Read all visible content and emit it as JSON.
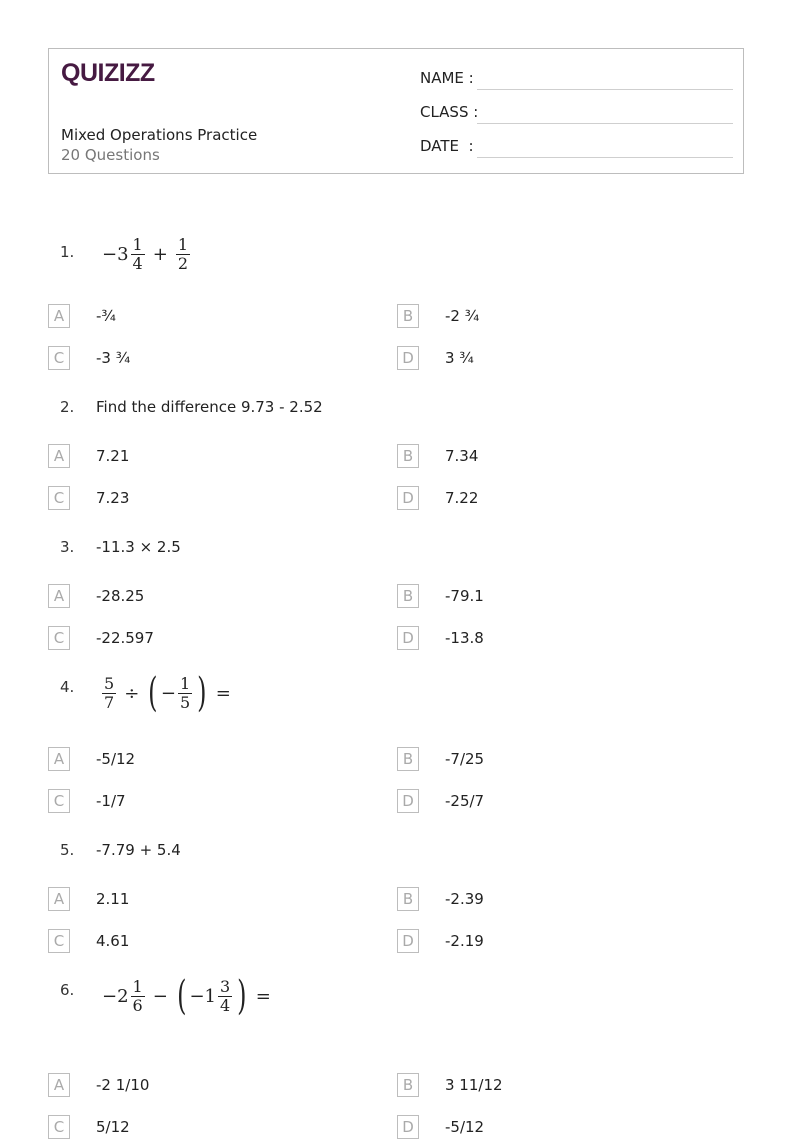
{
  "header": {
    "logo": "QUIZIZZ",
    "title": "Mixed Operations Practice",
    "question_count": "20 Questions",
    "fields": [
      "NAME :",
      "CLASS :",
      "DATE  :"
    ]
  },
  "questions": [
    {
      "number": "1.",
      "type": "math",
      "math": {
        "expr": "-3 1/4 + 1/2"
      },
      "options": [
        {
          "letter": "A",
          "text": "-¾"
        },
        {
          "letter": "B",
          "text": "-2 ¾"
        },
        {
          "letter": "C",
          "text": "-3 ¾"
        },
        {
          "letter": "D",
          "text": "3 ¾"
        }
      ]
    },
    {
      "number": "2.",
      "type": "text",
      "text": "Find the difference 9.73 - 2.52",
      "options": [
        {
          "letter": "A",
          "text": "7.21"
        },
        {
          "letter": "B",
          "text": "7.34"
        },
        {
          "letter": "C",
          "text": "7.23"
        },
        {
          "letter": "D",
          "text": "7.22"
        }
      ]
    },
    {
      "number": "3.",
      "type": "text",
      "text": "-11.3 × 2.5",
      "options": [
        {
          "letter": "A",
          "text": "-28.25"
        },
        {
          "letter": "B",
          "text": "-79.1"
        },
        {
          "letter": "C",
          "text": "-22.597"
        },
        {
          "letter": "D",
          "text": "-13.8"
        }
      ]
    },
    {
      "number": "4.",
      "type": "math",
      "math": {
        "expr": "5/7 ÷ (-1/5) ="
      },
      "options": [
        {
          "letter": "A",
          "text": "-5/12"
        },
        {
          "letter": "B",
          "text": "-7/25"
        },
        {
          "letter": "C",
          "text": "-1/7"
        },
        {
          "letter": "D",
          "text": "-25/7"
        }
      ]
    },
    {
      "number": "5.",
      "type": "text",
      "text": "-7.79 + 5.4",
      "options": [
        {
          "letter": "A",
          "text": "2.11"
        },
        {
          "letter": "B",
          "text": "-2.39"
        },
        {
          "letter": "C",
          "text": "4.61"
        },
        {
          "letter": "D",
          "text": "-2.19"
        }
      ]
    },
    {
      "number": "6.",
      "type": "math",
      "math": {
        "expr": "-2 1/6 - (-1 3/4) ="
      },
      "options": [
        {
          "letter": "A",
          "text": "-2 1/10"
        },
        {
          "letter": "B",
          "text": "3 11/12"
        },
        {
          "letter": "C",
          "text": "5/12"
        },
        {
          "letter": "D",
          "text": "-5/12"
        }
      ]
    }
  ],
  "math_parts": {
    "q1": {
      "minus3": "−3",
      "n1": "1",
      "d1": "4",
      "plus": "+",
      "n2": "1",
      "d2": "2"
    },
    "q4": {
      "n1": "5",
      "d1": "7",
      "div": "÷",
      "lp": "(",
      "minus": "−",
      "n2": "1",
      "d2": "5",
      "rp": ")",
      "eq": "="
    },
    "q6": {
      "minus2": "−2",
      "n1": "1",
      "d1": "6",
      "minus": "−",
      "lp": "(",
      "minus1": "−1",
      "n2": "3",
      "d2": "4",
      "rp": ")",
      "eq": "="
    }
  }
}
